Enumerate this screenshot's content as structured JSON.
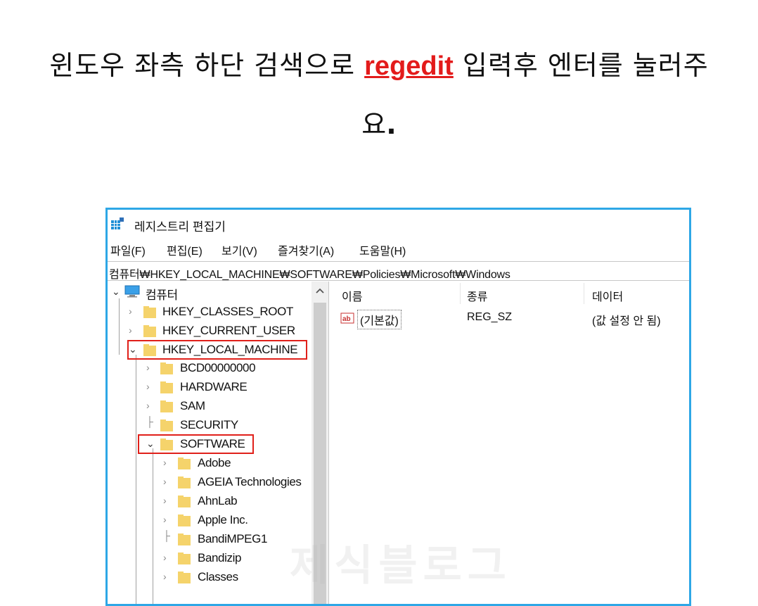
{
  "instruction": {
    "before": "윈도우 좌측 하단 검색으로 ",
    "command": "regedit",
    "after": " 입력후 엔터를 눌러주",
    "line2": "요",
    "line2_end": "."
  },
  "window": {
    "title": "레지스트리 편집기",
    "menu": [
      "파일(F)",
      "편집(E)",
      "보기(V)",
      "즐겨찾기(A)",
      "도움말(H)"
    ],
    "address": "컴퓨터₩HKEY_LOCAL_MACHINE₩SOFTWARE₩Policies₩Microsoft₩Windows",
    "tree": {
      "root": "컴퓨터",
      "hives": [
        "HKEY_CLASSES_ROOT",
        "HKEY_CURRENT_USER",
        "HKEY_LOCAL_MACHINE"
      ],
      "hklm_children": [
        "BCD00000000",
        "HARDWARE",
        "SAM",
        "SECURITY",
        "SOFTWARE"
      ],
      "software_children": [
        "Adobe",
        "AGEIA Technologies",
        "AhnLab",
        "Apple Inc.",
        "BandiMPEG1",
        "Bandizip",
        "Classes"
      ]
    },
    "list": {
      "columns": [
        "이름",
        "종류",
        "데이터"
      ],
      "rows": [
        {
          "name": "(기본값)",
          "type": "REG_SZ",
          "data": "(값 설정 안 됨)"
        }
      ]
    }
  },
  "watermark": "제식블로그",
  "colors": {
    "accent": "#2ea7e6",
    "highlight": "#e0201a",
    "command": "#e31b1b",
    "folder": "#f5d36b"
  }
}
